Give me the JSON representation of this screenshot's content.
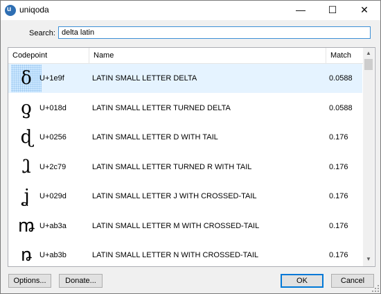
{
  "window": {
    "title": "uniqoda",
    "app_icon": "uniqoda-logo-icon",
    "controls": {
      "minimize": "—",
      "maximize": "☐",
      "close": "✕"
    }
  },
  "search": {
    "label": "Search:",
    "value": "delta latin"
  },
  "table": {
    "columns": [
      "Codepoint",
      "Name",
      "Match"
    ],
    "rows": [
      {
        "glyph": "ẟ",
        "codepoint": "U+1e9f",
        "name": "LATIN SMALL LETTER DELTA",
        "match": "0.0588",
        "selected": true
      },
      {
        "glyph": "ƍ",
        "codepoint": "U+018d",
        "name": "LATIN SMALL LETTER TURNED DELTA",
        "match": "0.0588"
      },
      {
        "glyph": "ɖ",
        "codepoint": "U+0256",
        "name": "LATIN SMALL LETTER D WITH TAIL",
        "match": "0.176"
      },
      {
        "glyph": "ⱹ",
        "codepoint": "U+2c79",
        "name": "LATIN SMALL LETTER TURNED R WITH TAIL",
        "match": "0.176"
      },
      {
        "glyph": "ʝ",
        "codepoint": "U+029d",
        "name": "LATIN SMALL LETTER J WITH CROSSED-TAIL",
        "match": "0.176"
      },
      {
        "glyph": "ꬺ",
        "codepoint": "U+ab3a",
        "name": "LATIN SMALL LETTER M WITH CROSSED-TAIL",
        "match": "0.176"
      },
      {
        "glyph": "ꬻ",
        "codepoint": "U+ab3b",
        "name": "LATIN SMALL LETTER N WITH CROSSED-TAIL",
        "match": "0.176"
      }
    ]
  },
  "scrollbar": {
    "up": "▲",
    "down": "▼"
  },
  "buttons": {
    "options": "Options...",
    "donate": "Donate...",
    "ok": "OK",
    "cancel": "Cancel"
  },
  "colors": {
    "selection": "#cce8ff",
    "focus": "#0078d7"
  }
}
